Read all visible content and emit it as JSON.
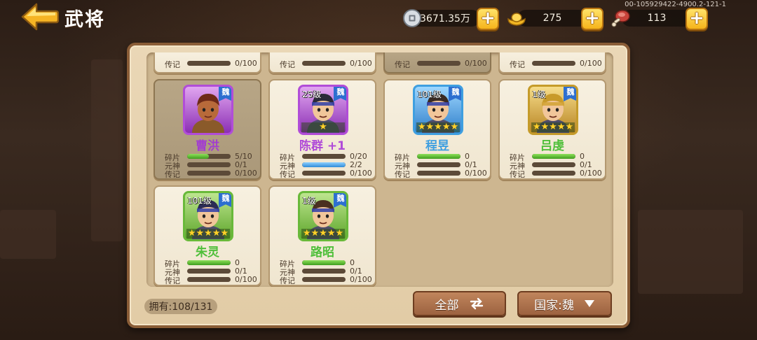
{
  "header": {
    "title": "武将",
    "build_id": "00-105929422-4900.2-121-1"
  },
  "resources": [
    {
      "name": "silver",
      "icon": "silver-coin-icon",
      "value": "3671.35万"
    },
    {
      "name": "gold",
      "icon": "gold-ingot-icon",
      "value": "275"
    },
    {
      "name": "meat",
      "icon": "meat-icon",
      "value": "113"
    }
  ],
  "partial_row": [
    {
      "label": "传记",
      "value": "0/100",
      "selected": false
    },
    {
      "label": "传记",
      "value": "0/100",
      "selected": false
    },
    {
      "label": "传记",
      "value": "0/100",
      "selected": true
    },
    {
      "label": "传记",
      "value": "0/100",
      "selected": false
    }
  ],
  "heroes": [
    {
      "name": "曹洪",
      "name_color": "#a23cd0",
      "level": "",
      "faction": "魏",
      "stars": 0,
      "frame": "purple",
      "selected": true,
      "stats": [
        {
          "label": "碎片",
          "value": "5/10",
          "fill": 0.5,
          "color": "green"
        },
        {
          "label": "元神",
          "value": "0/1",
          "fill": 0,
          "color": "green"
        },
        {
          "label": "传记",
          "value": "0/100",
          "fill": 0,
          "color": "green"
        }
      ]
    },
    {
      "name": "陈群  +1",
      "name_color": "#b04ad8",
      "level": "25级",
      "faction": "魏",
      "stars": 1,
      "frame": "purple",
      "selected": false,
      "stats": [
        {
          "label": "碎片",
          "value": "0/20",
          "fill": 0,
          "color": "green"
        },
        {
          "label": "元神",
          "value": "2/2",
          "fill": 1,
          "color": "blue"
        },
        {
          "label": "传记",
          "value": "0/100",
          "fill": 0,
          "color": "green"
        }
      ]
    },
    {
      "name": "程昱",
      "name_color": "#3f9fe0",
      "level": "101级",
      "faction": "魏",
      "stars": 5,
      "frame": "blue",
      "selected": false,
      "stats": [
        {
          "label": "碎片",
          "value": "0",
          "fill": 1,
          "color": "green"
        },
        {
          "label": "元神",
          "value": "0/1",
          "fill": 0,
          "color": "green"
        },
        {
          "label": "传记",
          "value": "0/100",
          "fill": 0,
          "color": "green"
        }
      ]
    },
    {
      "name": "吕虔",
      "name_color": "#4fbf3a",
      "level": "1级",
      "faction": "魏",
      "stars": 5,
      "frame": "gold",
      "selected": false,
      "stats": [
        {
          "label": "碎片",
          "value": "0",
          "fill": 1,
          "color": "green"
        },
        {
          "label": "元神",
          "value": "0/1",
          "fill": 0,
          "color": "green"
        },
        {
          "label": "传记",
          "value": "0/100",
          "fill": 0,
          "color": "green"
        }
      ]
    },
    {
      "name": "朱灵",
      "name_color": "#4fbf3a",
      "level": "101级",
      "faction": "魏",
      "stars": 5,
      "frame": "green",
      "selected": false,
      "stats": [
        {
          "label": "碎片",
          "value": "0",
          "fill": 1,
          "color": "green"
        },
        {
          "label": "元神",
          "value": "0/1",
          "fill": 0,
          "color": "green"
        },
        {
          "label": "传记",
          "value": "0/100",
          "fill": 0,
          "color": "green"
        }
      ]
    },
    {
      "name": "路昭",
      "name_color": "#4fbf3a",
      "level": "1级",
      "faction": "魏",
      "stars": 5,
      "frame": "green",
      "selected": false,
      "stats": [
        {
          "label": "碎片",
          "value": "0",
          "fill": 1,
          "color": "green"
        },
        {
          "label": "元神",
          "value": "0/1",
          "fill": 0,
          "color": "green"
        },
        {
          "label": "传记",
          "value": "0/100",
          "fill": 0,
          "color": "green"
        }
      ]
    }
  ],
  "footer": {
    "owned": "拥有:108/131",
    "filter_all": "全部",
    "country_filter": "国家:魏"
  }
}
